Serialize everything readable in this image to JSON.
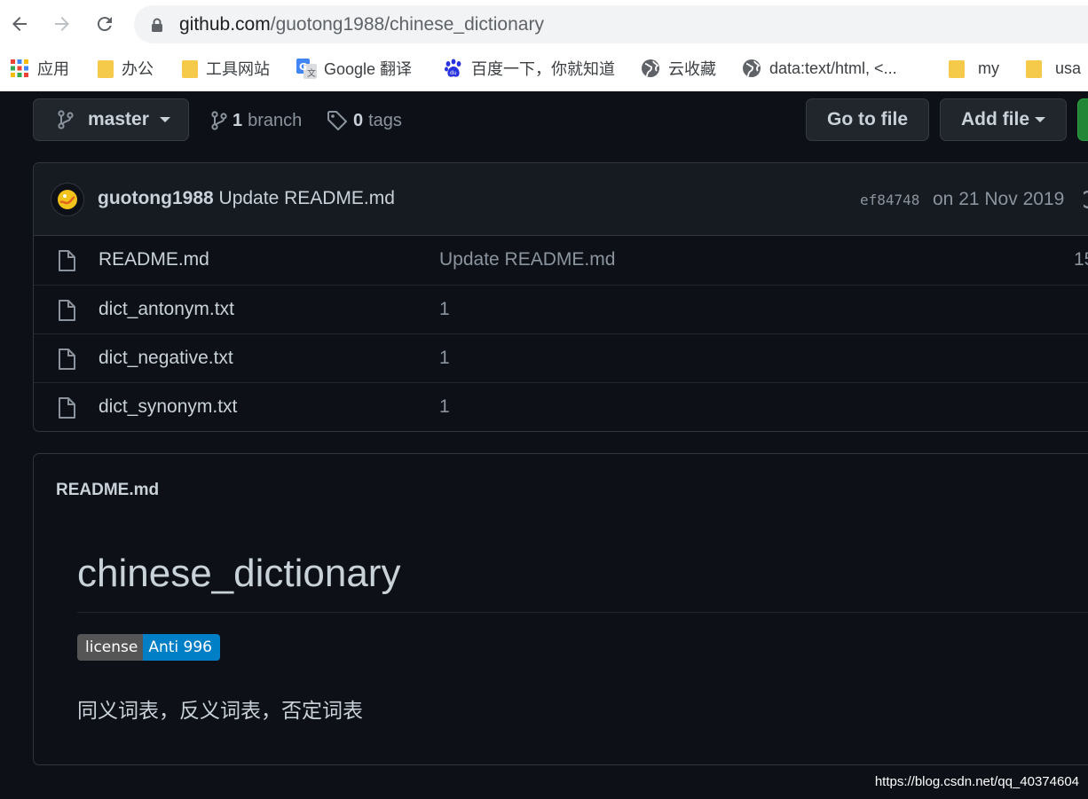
{
  "browser": {
    "url_host": "github.com",
    "url_path": "/guotong1988/chinese_dictionary",
    "bookmarks": [
      {
        "label": "应用",
        "icon": "apps-grid-icon"
      },
      {
        "label": "办公",
        "icon": "folder-icon"
      },
      {
        "label": "工具网站",
        "icon": "folder-icon"
      },
      {
        "label": "Google 翻译",
        "icon": "google-translate-icon"
      },
      {
        "label": "百度一下，你就知道",
        "icon": "baidu-paw-icon"
      },
      {
        "label": "云收藏",
        "icon": "globe-icon"
      },
      {
        "label": "data:text/html, <...",
        "icon": "globe-icon"
      },
      {
        "label": "my",
        "icon": "folder-icon"
      },
      {
        "label": "usa",
        "icon": "folder-icon"
      }
    ]
  },
  "repo": {
    "branch_button": "master",
    "branch_count": "1",
    "branch_label": "branch",
    "tag_count": "0",
    "tag_label": "tags",
    "go_to_file": "Go to file",
    "add_file": "Add file"
  },
  "latest_commit": {
    "author": "guotong1988",
    "message": "Update README.md",
    "sha": "ef84748",
    "date": "on 21 Nov 2019"
  },
  "files": [
    {
      "name": "README.md",
      "message": "Update README.md",
      "age": "15"
    },
    {
      "name": "dict_antonym.txt",
      "message": "1",
      "age": ""
    },
    {
      "name": "dict_negative.txt",
      "message": "1",
      "age": ""
    },
    {
      "name": "dict_synonym.txt",
      "message": "1",
      "age": ""
    }
  ],
  "readme": {
    "label": "README.md",
    "heading": "chinese_dictionary",
    "badge_left": "license",
    "badge_right": "Anti 996",
    "paragraph": "同义词表，反义词表，否定词表"
  },
  "watermark": "https://blog.csdn.net/qq_40374604",
  "colors": {
    "background": "#0d1117",
    "text": "#c9d1d9",
    "muted": "#8b949e",
    "border": "#30363d",
    "badge_blue": "#007ec6",
    "badge_gray": "#555555"
  }
}
